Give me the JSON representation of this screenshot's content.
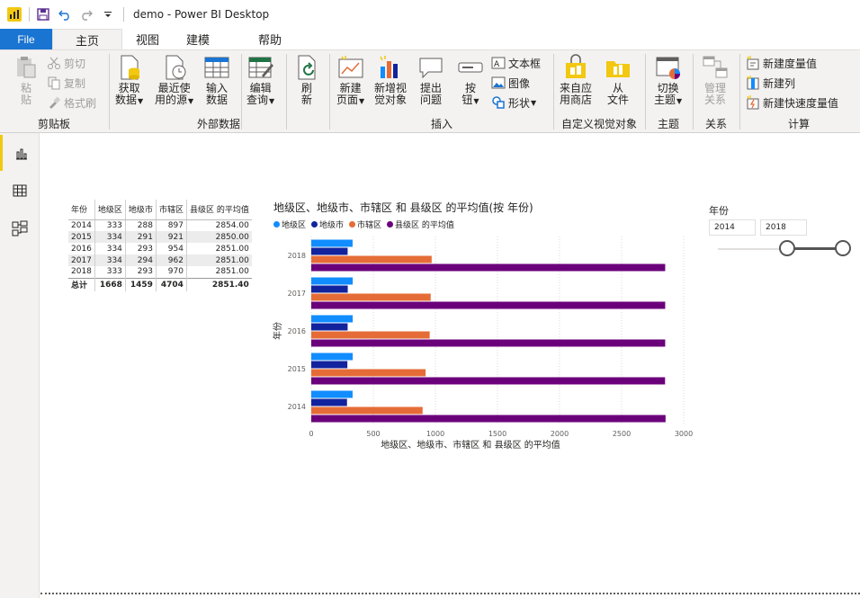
{
  "titlebar": {
    "app_title": "demo - Power BI Desktop"
  },
  "tabs": {
    "file": "File",
    "home": "主页",
    "view": "视图",
    "model": "建模",
    "help": "帮助"
  },
  "ribbon": {
    "clipboard": {
      "label": "剪贴板",
      "paste_1": "粘",
      "paste_2": "贴",
      "cut": "剪切",
      "copy": "复制",
      "format_painter": "格式刷"
    },
    "external": {
      "label": "外部数据",
      "get_data_1": "获取",
      "get_data_2": "数据",
      "recent_1": "最近使",
      "recent_2": "用的源",
      "enter_1": "输入",
      "enter_2": "数据",
      "edit_1": "编辑",
      "edit_2": "查询",
      "refresh_1": "刷",
      "refresh_2": "新"
    },
    "insert": {
      "label": "插入",
      "new_page_1": "新建",
      "new_page_2": "页面",
      "new_visual_1": "新增视",
      "new_visual_2": "觉对象",
      "ask_1": "提出",
      "ask_2": "问题",
      "button_1": "按",
      "button_2": "钮",
      "textbox": "文本框",
      "image": "图像",
      "shapes": "形状"
    },
    "custom": {
      "label": "自定义视觉对象",
      "store_1": "来自应",
      "store_2": "用商店",
      "file_1": "从",
      "file_2": "文件"
    },
    "themes": {
      "label": "主题",
      "switch_1": "切换",
      "switch_2": "主题"
    },
    "relationships": {
      "label": "关系",
      "manage_1": "管理",
      "manage_2": "关系"
    },
    "calculations": {
      "label": "计算",
      "new_measure": "新建度量值",
      "new_column": "新建列",
      "new_quick_measure": "新建快速度量值"
    }
  },
  "table": {
    "headers": [
      "年份",
      "地级区",
      "地级市",
      "市辖区",
      "县级区 的平均值"
    ],
    "rows": [
      [
        "2014",
        "333",
        "288",
        "897",
        "2854.00"
      ],
      [
        "2015",
        "334",
        "291",
        "921",
        "2850.00"
      ],
      [
        "2016",
        "334",
        "293",
        "954",
        "2851.00"
      ],
      [
        "2017",
        "334",
        "294",
        "962",
        "2851.00"
      ],
      [
        "2018",
        "333",
        "293",
        "970",
        "2851.00"
      ]
    ],
    "total": [
      "总计",
      "1668",
      "1459",
      "4704",
      "2851.40"
    ]
  },
  "chart": {
    "title": "地级区、地级市、市辖区 和 县级区 的平均值(按 年份)",
    "legend": [
      "地级区",
      "地级市",
      "市辖区",
      "县级区 的平均值"
    ]
  },
  "chart_data": {
    "type": "bar",
    "orientation": "horizontal",
    "title": "地级区、地级市、市辖区 和 县级区 的平均值(按 年份)",
    "xlabel": "地级区、地级市、市辖区 和 县级区 的平均值",
    "ylabel": "年份",
    "categories": [
      "2018",
      "2017",
      "2016",
      "2015",
      "2014"
    ],
    "series": [
      {
        "name": "地级区",
        "color": "#118dff",
        "values": [
          333,
          334,
          334,
          334,
          333
        ]
      },
      {
        "name": "地级市",
        "color": "#12239e",
        "values": [
          293,
          294,
          293,
          291,
          288
        ]
      },
      {
        "name": "市辖区",
        "color": "#e66c37",
        "values": [
          970,
          962,
          954,
          921,
          897
        ]
      },
      {
        "name": "县级区 的平均值",
        "color": "#6b007b",
        "values": [
          2851,
          2851,
          2851,
          2850,
          2854
        ]
      }
    ],
    "xlim": [
      0,
      3000
    ],
    "xticks": [
      0,
      500,
      1000,
      1500,
      2000,
      2500,
      3000
    ],
    "legend_position": "top-left",
    "grid": true
  },
  "slicer": {
    "title": "年份",
    "from": "2014",
    "to": "2018"
  },
  "colors": {
    "file_tab": "#1a74d2",
    "accent": "#f2c811"
  }
}
